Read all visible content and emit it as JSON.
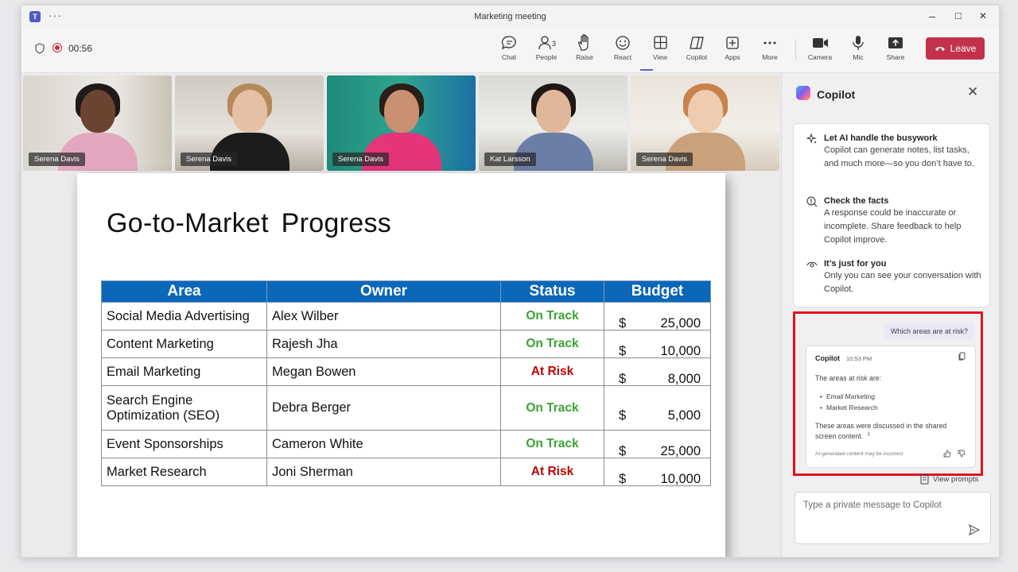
{
  "window": {
    "title": "Marketing meeting",
    "app_icon_label": "T",
    "more_label": "···",
    "controls": {
      "minimize": "–",
      "maximize": "□",
      "close": "✕"
    }
  },
  "toolbar": {
    "timer": "00:56",
    "buttons": [
      {
        "label": "Chat",
        "icon": "chat-icon"
      },
      {
        "label": "People",
        "icon": "people-icon",
        "count": "3"
      },
      {
        "label": "Raise",
        "icon": "raise-hand-icon"
      },
      {
        "label": "React",
        "icon": "react-icon"
      },
      {
        "label": "View",
        "icon": "view-icon"
      },
      {
        "label": "Copilot",
        "icon": "copilot-icon"
      },
      {
        "label": "Apps",
        "icon": "apps-icon"
      },
      {
        "label": "More",
        "icon": "more-icon"
      },
      {
        "label": "Camera",
        "icon": "camera-icon"
      },
      {
        "label": "Mic",
        "icon": "mic-icon"
      },
      {
        "label": "Share",
        "icon": "share-icon"
      }
    ],
    "leave_label": "Leave",
    "leave_color": "#c4314b"
  },
  "participants": [
    {
      "name": "Serena Davis"
    },
    {
      "name": "Serena Davis"
    },
    {
      "name": "Serena Davis"
    },
    {
      "name": "Kat Larsson"
    },
    {
      "name": "Serena Davis"
    }
  ],
  "slide": {
    "title": "Go-to-Market  Progress",
    "headers": [
      "Area",
      "Owner",
      "Status",
      "Budget"
    ],
    "rows": [
      {
        "area": "Social Media Advertising",
        "owner": "Alex Wilber",
        "status": "On Track",
        "currency": "$",
        "budget": "25,000"
      },
      {
        "area": "Content Marketing",
        "owner": "Rajesh Jha",
        "status": "On Track",
        "currency": "$",
        "budget": "10,000"
      },
      {
        "area": "Email Marketing",
        "owner": "Megan Bowen",
        "status": "At Risk",
        "currency": "$",
        "budget": "8,000"
      },
      {
        "area": "Search Engine Optimization (SEO)",
        "owner": "Debra Berger",
        "status": "On Track",
        "currency": "$",
        "budget": "5,000"
      },
      {
        "area": "Event Sponsorships",
        "owner": "Cameron White",
        "status": "On Track",
        "currency": "$",
        "budget": "25,000"
      },
      {
        "area": "Market Research",
        "owner": "Joni Sherman",
        "status": "At Risk",
        "currency": "$",
        "budget": "10,000"
      }
    ],
    "colors": {
      "header": "#0b67b8",
      "on_track": "#3aa335",
      "at_risk": "#c00000"
    }
  },
  "copilot": {
    "title": "Copilot",
    "info": [
      {
        "heading": "Let AI handle the busywork",
        "body": "Copilot can generate notes, list tasks, and much more—so you don’t have to."
      },
      {
        "heading": "Check the facts",
        "body": "A response could be inaccurate or incomplete. Share feedback to help Copilot improve."
      },
      {
        "heading": "It’s just for you",
        "body": "Only you can see your conversation with Copilot."
      }
    ],
    "user_question": "Which areas are at risk?",
    "reply": {
      "author": "Copilot",
      "time": "10:53 PM",
      "intro": "The areas at risk are:",
      "bullets": [
        "Email Marketing",
        "Market Research"
      ],
      "line1": "These areas were discussed in the shared",
      "line2": "screen content.",
      "citation": "1",
      "disclaimer": "AI-generated content may be incorrect"
    },
    "view_prompts": "View prompts",
    "input_placeholder": "Type a private message to Copilot",
    "highlight_color": "#e0141e"
  }
}
